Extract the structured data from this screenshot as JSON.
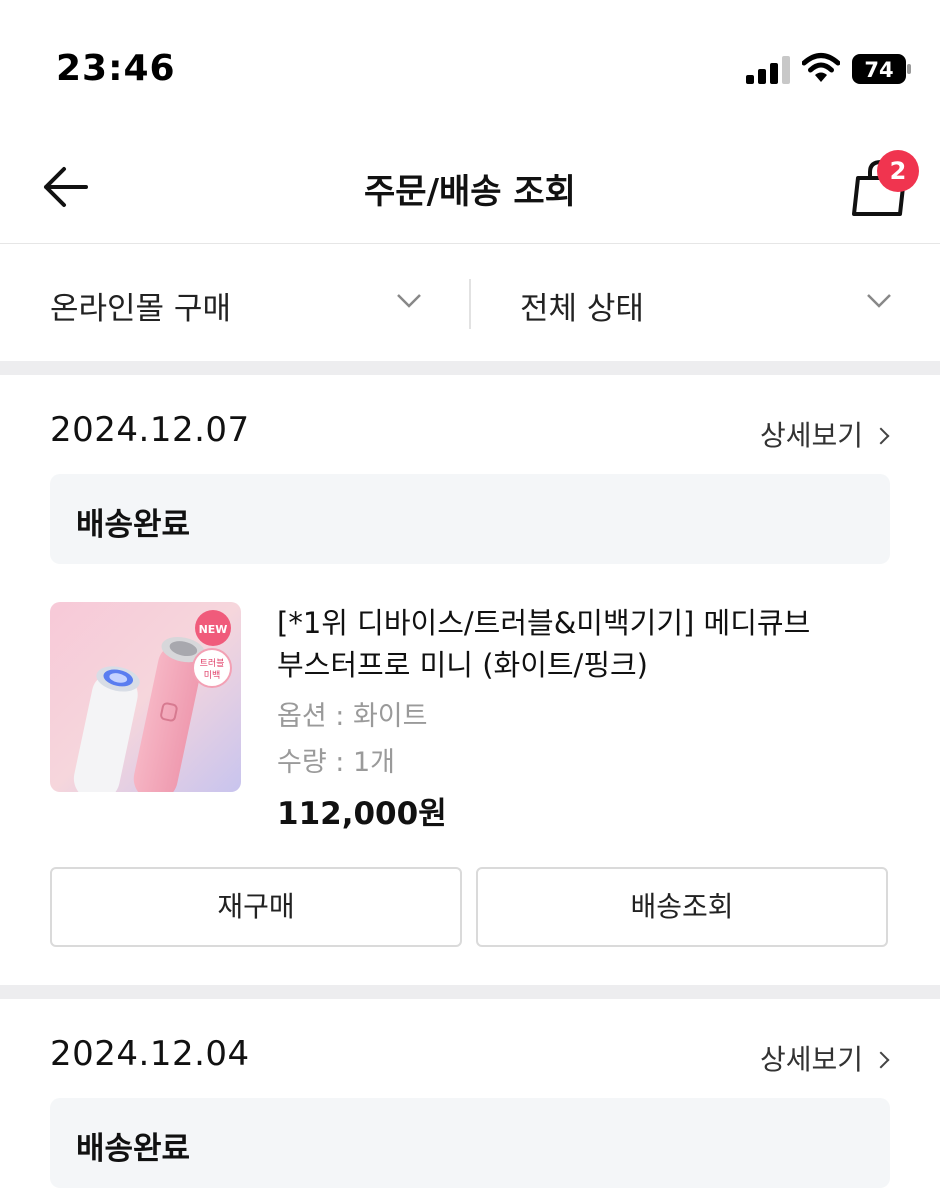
{
  "status_bar": {
    "time": "23:46",
    "battery": "74"
  },
  "header": {
    "title": "주문/배송 조회",
    "cart_count": "2"
  },
  "filters": {
    "channel": "온라인몰 구매",
    "status": "전체 상태"
  },
  "orders": [
    {
      "date": "2024.12.07",
      "detail_label": "상세보기",
      "status": "배송완료",
      "product": {
        "name": "[*1위 디바이스/트러블&미백기기] 메디큐브 부스터프로 미니 (화이트/핑크)",
        "option": "옵션 : 화이트",
        "quantity": "수량 : 1개",
        "price": "112,000원",
        "image_badge_new": "NEW",
        "image_badge_text_1": "트러블",
        "image_badge_text_2": "미백"
      },
      "buttons": {
        "rebuy": "재구매",
        "track": "배송조회"
      }
    },
    {
      "date": "2024.12.04",
      "detail_label": "상세보기",
      "status": "배송완료"
    }
  ],
  "colors": {
    "badge": "#f0344f",
    "status_box_bg": "#f4f6f8",
    "divider_bg": "#ededef"
  }
}
